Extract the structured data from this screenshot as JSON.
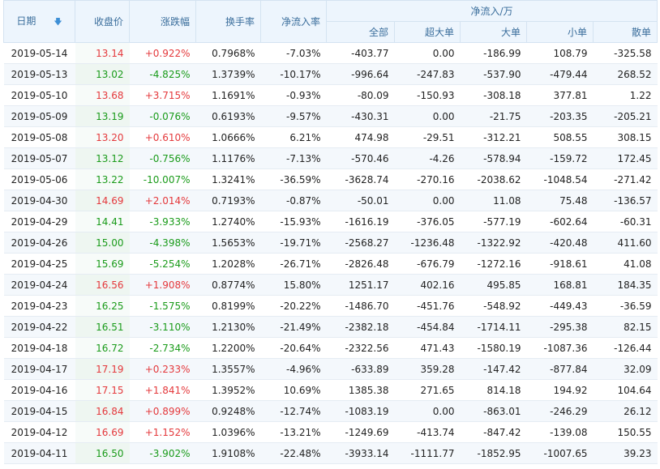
{
  "header": {
    "date": "日期",
    "close": "收盘价",
    "change": "涨跌幅",
    "turnover": "换手率",
    "net_ratio": "净流入率",
    "net_group": "净流入/万",
    "sub": [
      "全部",
      "超大单",
      "大单",
      "小单",
      "散单"
    ]
  },
  "colors": {
    "up": "#e4393c",
    "down": "#1a9b1a",
    "header_bg": "#edf5fd",
    "header_text": "#3b6e9c"
  },
  "rows": [
    {
      "date": "2019-05-14",
      "close": "13.14",
      "change": "+0.922%",
      "turnover": "0.7968%",
      "ratio": "-7.03%",
      "all": "-403.77",
      "xl": "0.00",
      "l": "-186.99",
      "s": "108.79",
      "r": "-325.58",
      "dir": "up"
    },
    {
      "date": "2019-05-13",
      "close": "13.02",
      "change": "-4.825%",
      "turnover": "1.3739%",
      "ratio": "-10.17%",
      "all": "-996.64",
      "xl": "-247.83",
      "l": "-537.90",
      "s": "-479.44",
      "r": "268.52",
      "dir": "down"
    },
    {
      "date": "2019-05-10",
      "close": "13.68",
      "change": "+3.715%",
      "turnover": "1.1691%",
      "ratio": "-0.93%",
      "all": "-80.09",
      "xl": "-150.93",
      "l": "-308.18",
      "s": "377.81",
      "r": "1.22",
      "dir": "up"
    },
    {
      "date": "2019-05-09",
      "close": "13.19",
      "change": "-0.076%",
      "turnover": "0.6193%",
      "ratio": "-9.57%",
      "all": "-430.31",
      "xl": "0.00",
      "l": "-21.75",
      "s": "-203.35",
      "r": "-205.21",
      "dir": "down"
    },
    {
      "date": "2019-05-08",
      "close": "13.20",
      "change": "+0.610%",
      "turnover": "1.0666%",
      "ratio": "6.21%",
      "all": "474.98",
      "xl": "-29.51",
      "l": "-312.21",
      "s": "508.55",
      "r": "308.15",
      "dir": "up"
    },
    {
      "date": "2019-05-07",
      "close": "13.12",
      "change": "-0.756%",
      "turnover": "1.1176%",
      "ratio": "-7.13%",
      "all": "-570.46",
      "xl": "-4.26",
      "l": "-578.94",
      "s": "-159.72",
      "r": "172.45",
      "dir": "down"
    },
    {
      "date": "2019-05-06",
      "close": "13.22",
      "change": "-10.007%",
      "turnover": "1.3241%",
      "ratio": "-36.59%",
      "all": "-3628.74",
      "xl": "-270.16",
      "l": "-2038.62",
      "s": "-1048.54",
      "r": "-271.42",
      "dir": "down"
    },
    {
      "date": "2019-04-30",
      "close": "14.69",
      "change": "+2.014%",
      "turnover": "0.7193%",
      "ratio": "-0.87%",
      "all": "-50.01",
      "xl": "0.00",
      "l": "11.08",
      "s": "75.48",
      "r": "-136.57",
      "dir": "up"
    },
    {
      "date": "2019-04-29",
      "close": "14.41",
      "change": "-3.933%",
      "turnover": "1.2740%",
      "ratio": "-15.93%",
      "all": "-1616.19",
      "xl": "-376.05",
      "l": "-577.19",
      "s": "-602.64",
      "r": "-60.31",
      "dir": "down"
    },
    {
      "date": "2019-04-26",
      "close": "15.00",
      "change": "-4.398%",
      "turnover": "1.5653%",
      "ratio": "-19.71%",
      "all": "-2568.27",
      "xl": "-1236.48",
      "l": "-1322.92",
      "s": "-420.48",
      "r": "411.60",
      "dir": "down"
    },
    {
      "date": "2019-04-25",
      "close": "15.69",
      "change": "-5.254%",
      "turnover": "1.2028%",
      "ratio": "-26.71%",
      "all": "-2826.48",
      "xl": "-676.79",
      "l": "-1272.16",
      "s": "-918.61",
      "r": "41.08",
      "dir": "down"
    },
    {
      "date": "2019-04-24",
      "close": "16.56",
      "change": "+1.908%",
      "turnover": "0.8774%",
      "ratio": "15.80%",
      "all": "1251.17",
      "xl": "402.16",
      "l": "495.85",
      "s": "168.81",
      "r": "184.35",
      "dir": "up"
    },
    {
      "date": "2019-04-23",
      "close": "16.25",
      "change": "-1.575%",
      "turnover": "0.8199%",
      "ratio": "-20.22%",
      "all": "-1486.70",
      "xl": "-451.76",
      "l": "-548.92",
      "s": "-449.43",
      "r": "-36.59",
      "dir": "down"
    },
    {
      "date": "2019-04-22",
      "close": "16.51",
      "change": "-3.110%",
      "turnover": "1.2130%",
      "ratio": "-21.49%",
      "all": "-2382.18",
      "xl": "-454.84",
      "l": "-1714.11",
      "s": "-295.38",
      "r": "82.15",
      "dir": "down"
    },
    {
      "date": "2019-04-18",
      "close": "16.72",
      "change": "-2.734%",
      "turnover": "1.2200%",
      "ratio": "-20.64%",
      "all": "-2322.56",
      "xl": "471.43",
      "l": "-1580.19",
      "s": "-1087.36",
      "r": "-126.44",
      "dir": "down"
    },
    {
      "date": "2019-04-17",
      "close": "17.19",
      "change": "+0.233%",
      "turnover": "1.3557%",
      "ratio": "-4.96%",
      "all": "-633.89",
      "xl": "359.28",
      "l": "-147.42",
      "s": "-877.84",
      "r": "32.09",
      "dir": "up"
    },
    {
      "date": "2019-04-16",
      "close": "17.15",
      "change": "+1.841%",
      "turnover": "1.3952%",
      "ratio": "10.69%",
      "all": "1385.38",
      "xl": "271.65",
      "l": "814.18",
      "s": "194.92",
      "r": "104.64",
      "dir": "up"
    },
    {
      "date": "2019-04-15",
      "close": "16.84",
      "change": "+0.899%",
      "turnover": "0.9248%",
      "ratio": "-12.74%",
      "all": "-1083.19",
      "xl": "0.00",
      "l": "-863.01",
      "s": "-246.29",
      "r": "26.12",
      "dir": "up"
    },
    {
      "date": "2019-04-12",
      "close": "16.69",
      "change": "+1.152%",
      "turnover": "1.0396%",
      "ratio": "-13.21%",
      "all": "-1249.69",
      "xl": "-413.74",
      "l": "-847.42",
      "s": "-139.08",
      "r": "150.55",
      "dir": "up"
    },
    {
      "date": "2019-04-11",
      "close": "16.50",
      "change": "-3.902%",
      "turnover": "1.9108%",
      "ratio": "-22.48%",
      "all": "-3933.14",
      "xl": "-1111.77",
      "l": "-1852.95",
      "s": "-1007.65",
      "r": "39.23",
      "dir": "down"
    }
  ]
}
